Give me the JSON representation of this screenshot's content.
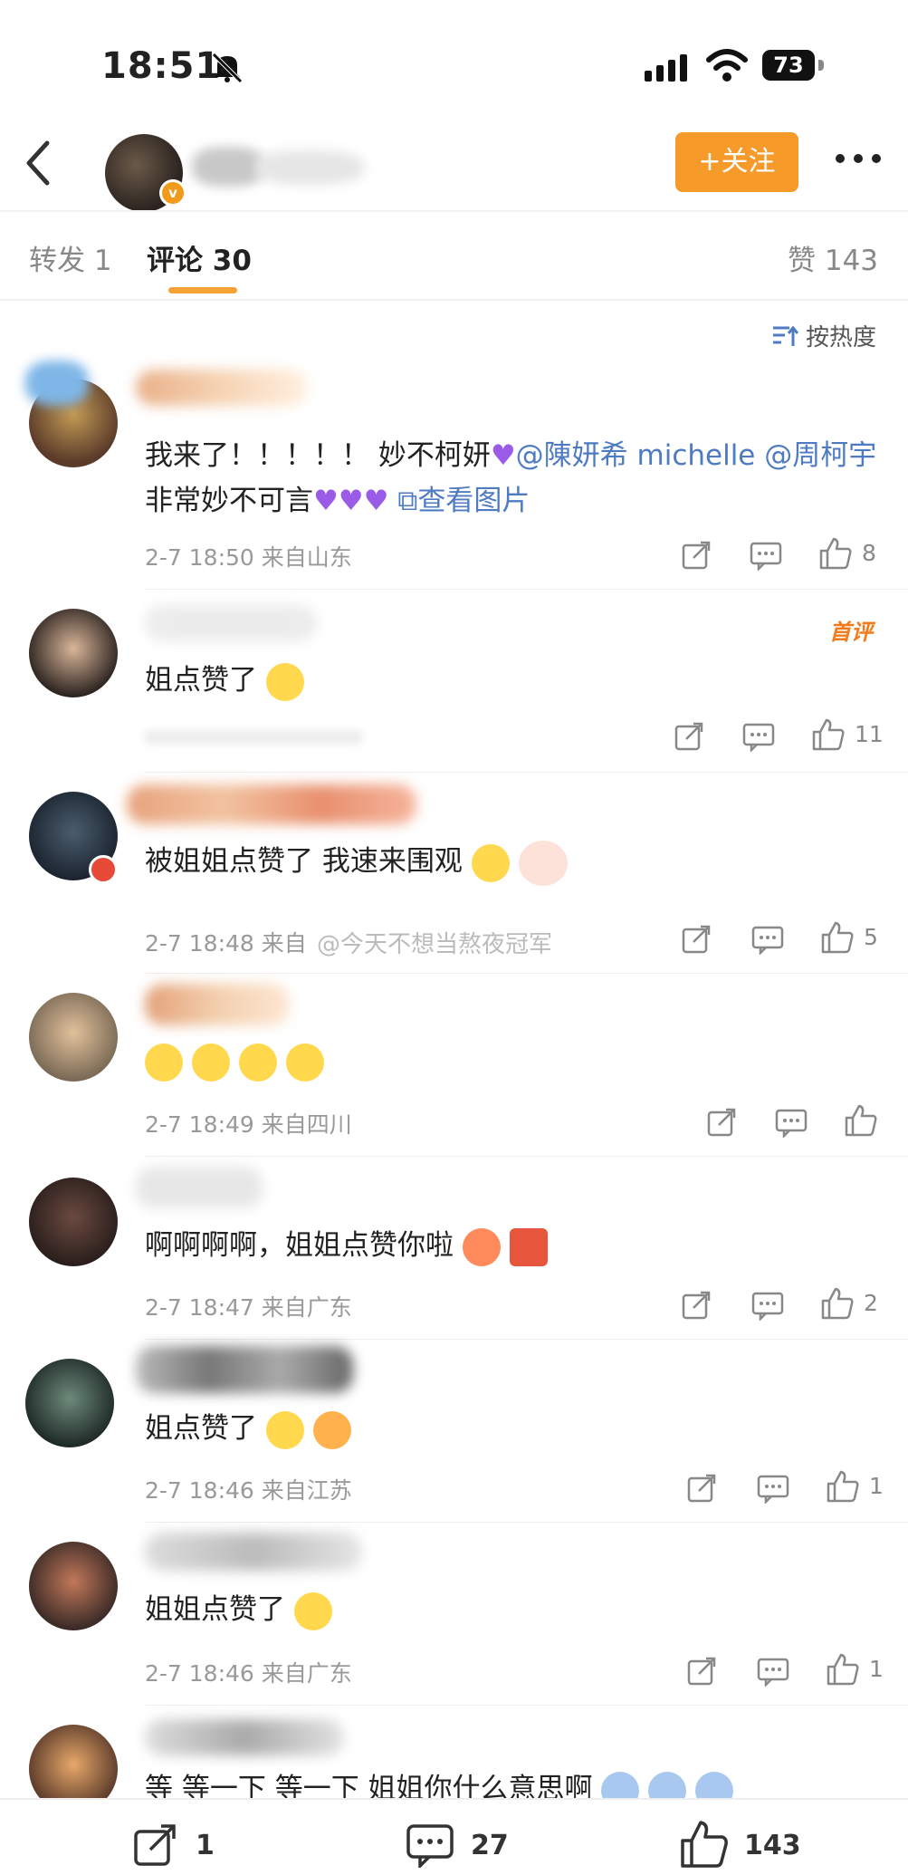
{
  "status_bar": {
    "time": "18:51",
    "battery": "73"
  },
  "header": {
    "follow_label": "+关注"
  },
  "tabs": {
    "repost": "转发 1",
    "comments": "评论 30",
    "likes": "赞 143"
  },
  "sort_label": "按热度",
  "comments": [
    {
      "text_a": "我来了！！！！！  妙不柯妍",
      "mention1": "@陳妍希 michelle",
      "mention2": "@周柯宇",
      "text_b": " 非常妙不可言",
      "view_image": "查看图片",
      "meta": "2-7 18:50  来自山东",
      "likes": "8"
    },
    {
      "text": "姐点赞了",
      "badge": "首评",
      "likes": "11"
    },
    {
      "text": "被姐姐点赞了 我速来围观",
      "meta": "2-7 18:48  来自",
      "likes": "5"
    },
    {
      "text": "",
      "meta": "2-7 18:49  来自四川",
      "likes": ""
    },
    {
      "text": "啊啊啊啊，姐姐点赞你啦",
      "meta": "2-7 18:47  来自广东",
      "likes": "2"
    },
    {
      "text": "姐点赞了",
      "meta": "2-7 18:46  来自江苏",
      "likes": "1"
    },
    {
      "text": "姐姐点赞了",
      "meta": "2-7 18:46  来自广东",
      "likes": "1"
    },
    {
      "text": "等 等一下 等一下 姐姐你什么意思啊"
    }
  ],
  "watermark": "@今天不想当熬夜冠军",
  "bottom_bar": {
    "reposts": "1",
    "comments": "27",
    "likes": "143"
  },
  "colors": {
    "accent": "#f69a2a",
    "link": "#4f7bc3",
    "heart": "#9a5ce6"
  }
}
